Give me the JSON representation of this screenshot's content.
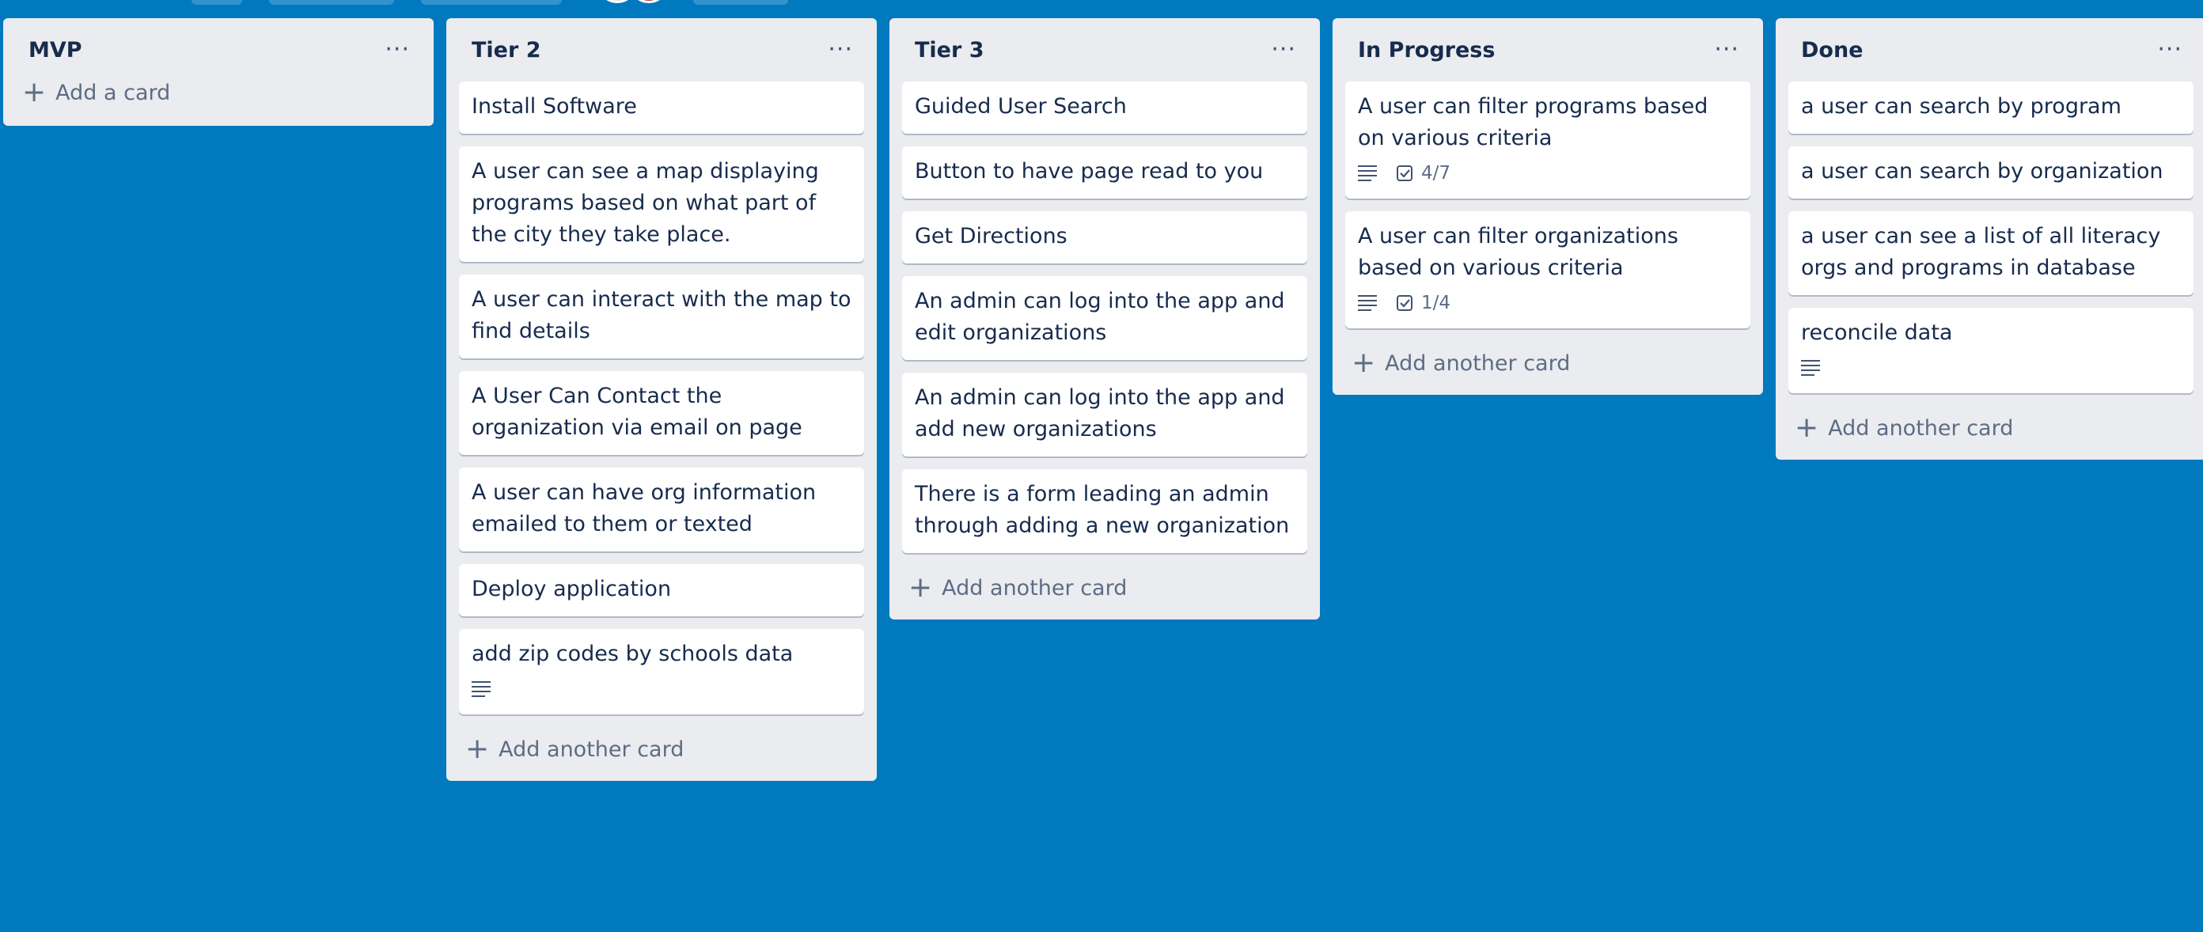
{
  "lists": [
    {
      "title": "MVP",
      "add_label": "Add a card",
      "cards": []
    },
    {
      "title": "Tier 2",
      "add_label": "Add another card",
      "cards": [
        {
          "text": "Install Software"
        },
        {
          "text": "A user can see a map displaying programs based on what part of the city they take place."
        },
        {
          "text": "A user can interact with the map to find details"
        },
        {
          "text": "A User Can Contact the organization via email on page"
        },
        {
          "text": "A user can have org information emailed to them or texted"
        },
        {
          "text": "Deploy application"
        },
        {
          "text": "add zip codes by schools data",
          "has_description": true
        }
      ]
    },
    {
      "title": "Tier 3",
      "add_label": "Add another card",
      "cards": [
        {
          "text": "Guided User Search"
        },
        {
          "text": "Button to have page read to you"
        },
        {
          "text": "Get Directions"
        },
        {
          "text": "An admin can log into the app and edit organizations"
        },
        {
          "text": "An admin can log into the app and add new organizations"
        },
        {
          "text": "There is a form leading an admin through adding a new organization"
        }
      ]
    },
    {
      "title": "In Progress",
      "add_label": "Add another card",
      "cards": [
        {
          "text": "A user can filter programs based on various criteria",
          "has_description": true,
          "checklist": "4/7"
        },
        {
          "text": "A user can filter organizations based on various criteria",
          "has_description": true,
          "checklist": "1/4"
        }
      ]
    },
    {
      "title": "Done",
      "add_label": "Add another card",
      "cards": [
        {
          "text": "a user can search by program"
        },
        {
          "text": "a user can search by organization"
        },
        {
          "text": "a user can see a list of all literacy orgs and programs in database"
        },
        {
          "text": "reconcile data",
          "has_description": true
        }
      ]
    }
  ],
  "icons": {
    "list_menu": "ellipsis-icon",
    "add": "plus-icon",
    "description": "description-icon",
    "checklist": "checklist-icon"
  },
  "colors": {
    "board_background": "#0079bf",
    "list_background": "#ebecf0",
    "card_background": "#ffffff",
    "text": "#172b4d",
    "muted_text": "#5e6c84"
  },
  "menu_glyph": "···",
  "plus_glyph": "+"
}
